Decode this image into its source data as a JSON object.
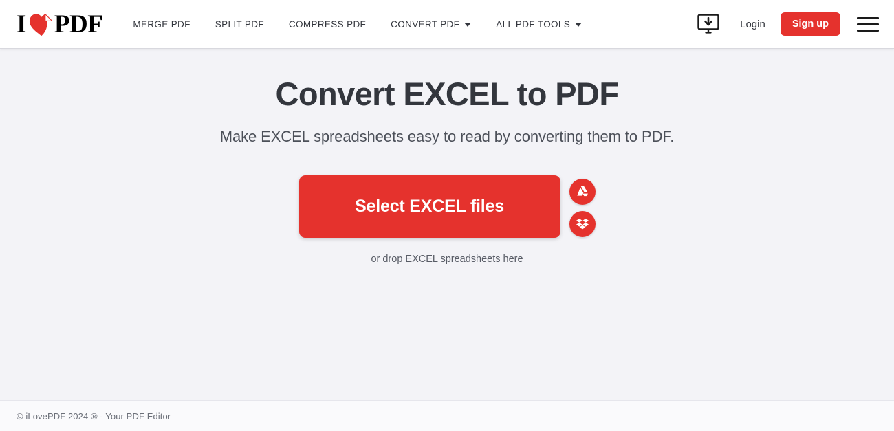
{
  "header": {
    "logo": {
      "text_left": "I",
      "text_right": "PDF",
      "heart_icon": "heart-page-icon",
      "accent_color": "#e5322d"
    },
    "nav_items": [
      {
        "label": "MERGE PDF",
        "has_caret": false
      },
      {
        "label": "SPLIT PDF",
        "has_caret": false
      },
      {
        "label": "COMPRESS PDF",
        "has_caret": false
      },
      {
        "label": "CONVERT PDF",
        "has_caret": true
      },
      {
        "label": "ALL PDF TOOLS",
        "has_caret": true
      }
    ],
    "desktop_download_icon": "monitor-download-icon",
    "login_label": "Login",
    "signup_label": "Sign up",
    "menu_icon": "hamburger-menu-icon"
  },
  "main": {
    "title": "Convert EXCEL to PDF",
    "subtitle": "Make EXCEL spreadsheets easy to read by converting them to PDF.",
    "select_button_label": "Select EXCEL files",
    "cloud_buttons": [
      {
        "name": "google-drive",
        "icon": "google-drive-icon"
      },
      {
        "name": "dropbox",
        "icon": "dropbox-icon"
      }
    ],
    "drop_hint": "or drop EXCEL spreadsheets here"
  },
  "footer": {
    "copyright": "© iLovePDF 2024 ® - Your PDF Editor"
  },
  "theme": {
    "brand_red": "#e5322d",
    "page_background": "#f3f3f7",
    "header_background": "#ffffff",
    "footer_background": "#fafafc",
    "text_dark": "#33363d"
  }
}
